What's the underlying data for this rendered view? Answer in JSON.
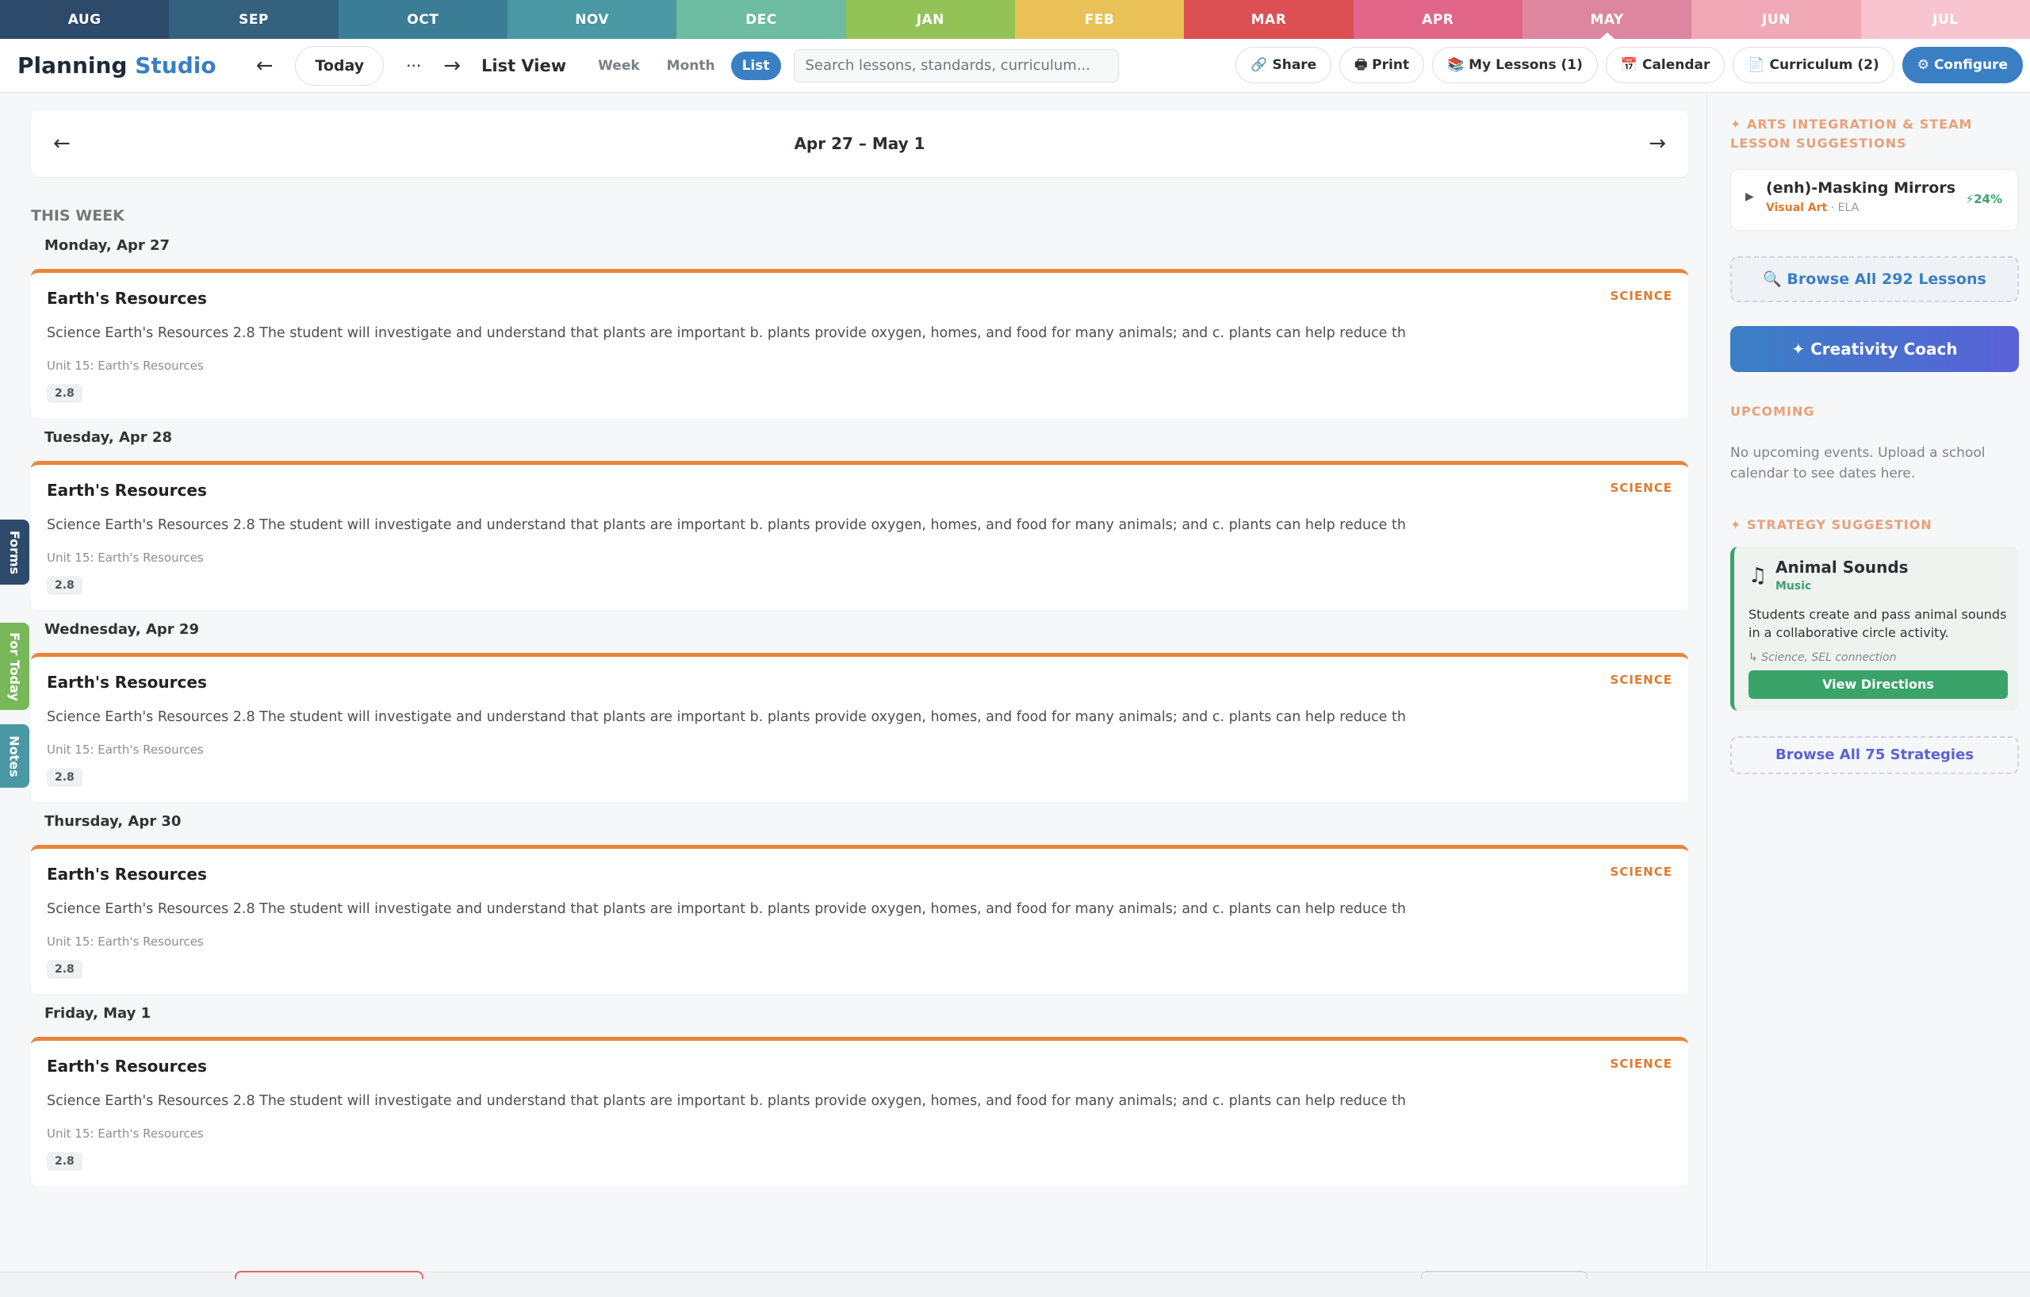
{
  "months": [
    {
      "label": "AUG",
      "color": "#2e4a6b"
    },
    {
      "label": "SEP",
      "color": "#33617e"
    },
    {
      "label": "OCT",
      "color": "#3b7d95"
    },
    {
      "label": "NOV",
      "color": "#4a98a3"
    },
    {
      "label": "DEC",
      "color": "#6dbba0"
    },
    {
      "label": "JAN",
      "color": "#93c356"
    },
    {
      "label": "FEB",
      "color": "#e9c157"
    },
    {
      "label": "MAR",
      "color": "#dc4f52"
    },
    {
      "label": "APR",
      "color": "#e2668a"
    },
    {
      "label": "MAY",
      "color": "#dc879f"
    },
    {
      "label": "JUN",
      "color": "#f0a7b6"
    },
    {
      "label": "JUL",
      "color": "#f7c4cf"
    }
  ],
  "active_month": "MAY",
  "header": {
    "brand_main": "Planning",
    "brand_accent": "Studio",
    "prev": "←",
    "today": "Today",
    "more": "···",
    "next": "→",
    "view_label": "List View",
    "views": [
      "Week",
      "Month",
      "List"
    ],
    "active_view": "List",
    "search_placeholder": "Search lessons, standards, curriculum...",
    "tools": {
      "share": "🔗 Share",
      "print": "🖶 Print",
      "my_lessons": "📚 My Lessons (1)",
      "calendar": "📅 Calendar",
      "curriculum": "📄 Curriculum (2)",
      "configure": "⚙ Configure"
    }
  },
  "side_tabs": [
    {
      "label": "Forms",
      "color": "#2e4a6b"
    },
    {
      "label": "For Today",
      "color": "#78b85a"
    },
    {
      "label": "Notes",
      "color": "#4a98a3"
    }
  ],
  "range": {
    "prev": "←",
    "label": "Apr 27 – May 1",
    "next": "→"
  },
  "this_week": "THIS WEEK",
  "days": [
    {
      "name": "Monday, Apr 27",
      "title": "Earth's Resources",
      "subject": "SCIENCE",
      "desc": "Science Earth's Resources 2.8 The student will investigate and understand that plants are important b. plants provide oxygen, homes, and food for many animals; and c. plants can help reduce th",
      "unit": "Unit 15: Earth's Resources",
      "tag": "2.8"
    },
    {
      "name": "Tuesday, Apr 28",
      "title": "Earth's Resources",
      "subject": "SCIENCE",
      "desc": "Science Earth's Resources 2.8 The student will investigate and understand that plants are important b. plants provide oxygen, homes, and food for many animals; and c. plants can help reduce th",
      "unit": "Unit 15: Earth's Resources",
      "tag": "2.8"
    },
    {
      "name": "Wednesday, Apr 29",
      "title": "Earth's Resources",
      "subject": "SCIENCE",
      "desc": "Science Earth's Resources 2.8 The student will investigate and understand that plants are important b. plants provide oxygen, homes, and food for many animals; and c. plants can help reduce th",
      "unit": "Unit 15: Earth's Resources",
      "tag": "2.8"
    },
    {
      "name": "Thursday, Apr 30",
      "title": "Earth's Resources",
      "subject": "SCIENCE",
      "desc": "Science Earth's Resources 2.8 The student will investigate and understand that plants are important b. plants provide oxygen, homes, and food for many animals; and c. plants can help reduce th",
      "unit": "Unit 15: Earth's Resources",
      "tag": "2.8"
    },
    {
      "name": "Friday, May 1",
      "title": "Earth's Resources",
      "subject": "SCIENCE",
      "desc": "Science Earth's Resources 2.8 The student will investigate and understand that plants are important b. plants provide oxygen, homes, and food for many animals; and c. plants can help reduce th",
      "unit": "Unit 15: Earth's Resources",
      "tag": "2.8"
    }
  ],
  "sidebar": {
    "arts_heading": "✦ ARTS INTEGRATION & STEAM LESSON SUGGESTIONS",
    "lesson": {
      "title": "(enh)-Masking Mirrors",
      "subject": "Visual Art",
      "secondary": " · ELA",
      "match": "⚡24%"
    },
    "browse_lessons": "🔍 Browse All 292 Lessons",
    "coach": "✦ Creativity Coach",
    "upcoming_heading": "UPCOMING",
    "upcoming_text": "No upcoming events. Upload a school calendar to see dates here.",
    "strategy_heading": "✦ STRATEGY SUGGESTION",
    "strategy": {
      "title": "Animal Sounds",
      "subject": "Music",
      "desc": "Students create and pass animal sounds in a collaborative circle activity.",
      "connection": "↳ Science, SEL connection",
      "button": "View Directions"
    },
    "browse_strategies": "Browse All 75 Strategies"
  },
  "colors": {
    "accent": "#3a7fc4",
    "science": "#e07a2f",
    "strategy": "#3aa36a"
  }
}
